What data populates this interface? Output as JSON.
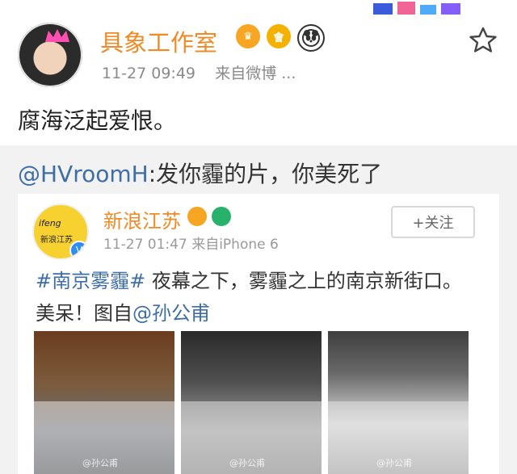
{
  "post": {
    "username": "具象工作室",
    "badges": [
      {
        "name": "crown-badge-icon",
        "text": ""
      },
      {
        "name": "level-badge-icon",
        "text": "會"
      },
      {
        "name": "panda-badge-icon",
        "text": ""
      }
    ],
    "time": "11-27 09:49",
    "source": "来自微博 ...",
    "text": "腐海泛起爱恨。"
  },
  "repost": {
    "mention": "@HVroomH",
    "comment": ":发你霾的片，你美死了"
  },
  "inner": {
    "username": "新浪江苏",
    "time": "11-27 01:47 来自iPhone 6",
    "follow_label": "+关注",
    "topic": "#南京雾霾#",
    "text_rest": " 夜幕之下，雾霾之上的南京新街口。美呆！图自",
    "mention": "@孙公甫"
  },
  "colors": {
    "username": "#f08a24",
    "link": "#3d6ea6",
    "muted": "#8a8a8a"
  }
}
